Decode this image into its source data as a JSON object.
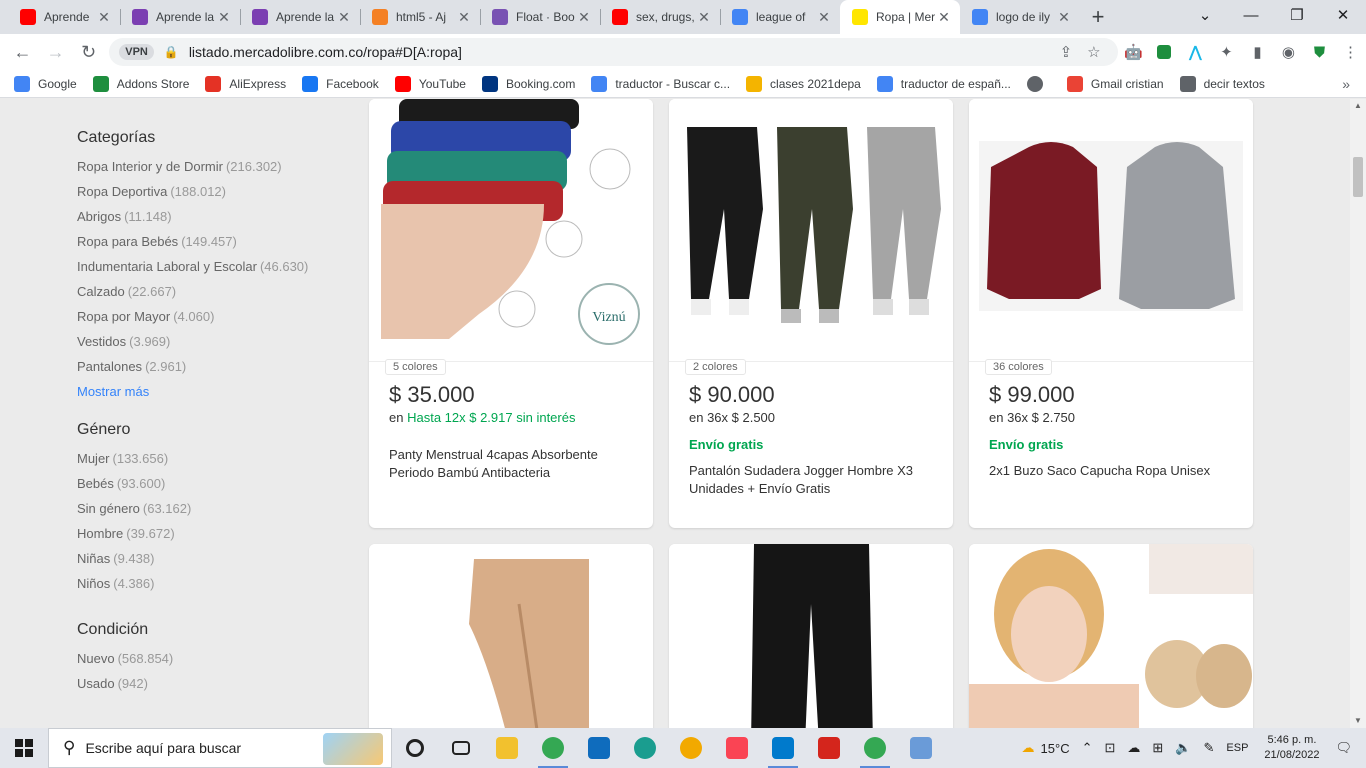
{
  "browser": {
    "tabs": [
      {
        "title": "Aprende",
        "favicon": "youtube-icon",
        "color": "#ff0000",
        "active": false
      },
      {
        "title": "Aprende la",
        "favicon": "potion-icon",
        "color": "#7b3fb2",
        "active": false
      },
      {
        "title": "Aprende la",
        "favicon": "potion-icon",
        "color": "#7b3fb2",
        "active": false
      },
      {
        "title": "html5 - Aj",
        "favicon": "stackoverflow-icon",
        "color": "#f48024",
        "active": false
      },
      {
        "title": "Float · Boo",
        "favicon": "bootstrap-icon",
        "color": "#7952b3",
        "active": false
      },
      {
        "title": "sex, drugs,",
        "favicon": "youtube-icon",
        "color": "#ff0000",
        "active": false
      },
      {
        "title": "league of",
        "favicon": "google-icon",
        "color": "#4285f4",
        "active": false
      },
      {
        "title": "Ropa | Mer",
        "favicon": "mercadolibre-icon",
        "color": "#ffe600",
        "active": true
      },
      {
        "title": "logo de ily",
        "favicon": "google-icon",
        "color": "#4285f4",
        "active": false
      }
    ],
    "url": "listado.mercadolibre.com.co/ropa#D[A:ropa]",
    "vpn_label": "VPN",
    "bookmarks": [
      {
        "label": "Google",
        "icon": "google-icon",
        "color": "#4285f4"
      },
      {
        "label": "Addons Store",
        "icon": "addons-icon",
        "color": "#1e8e3e"
      },
      {
        "label": "AliExpress",
        "icon": "aliexpress-icon",
        "color": "#e43225"
      },
      {
        "label": "Facebook",
        "icon": "facebook-icon",
        "color": "#1877f2"
      },
      {
        "label": "YouTube",
        "icon": "youtube-icon",
        "color": "#ff0000"
      },
      {
        "label": "Booking.com",
        "icon": "booking-icon",
        "color": "#003580"
      },
      {
        "label": "traductor - Buscar c...",
        "icon": "google-icon",
        "color": "#4285f4"
      },
      {
        "label": "clases 2021depa",
        "icon": "classroom-icon",
        "color": "#f4b400"
      },
      {
        "label": "traductor de españ...",
        "icon": "google-icon",
        "color": "#4285f4"
      },
      {
        "label": "",
        "icon": "globe-icon",
        "color": "#5f6368"
      },
      {
        "label": "Gmail cristian",
        "icon": "gmail-icon",
        "color": "#ea4335"
      },
      {
        "label": "decir textos",
        "icon": "speaker-icon",
        "color": "#5f6368"
      }
    ]
  },
  "filters": [
    {
      "title": "Categorías",
      "items": [
        {
          "label": "Ropa Interior y de Dormir",
          "count": "(216.302)"
        },
        {
          "label": "Ropa Deportiva",
          "count": "(188.012)"
        },
        {
          "label": "Abrigos",
          "count": "(11.148)"
        },
        {
          "label": "Ropa para Bebés",
          "count": "(149.457)"
        },
        {
          "label": "Indumentaria Laboral y Escolar",
          "count": "(46.630)"
        },
        {
          "label": "Calzado",
          "count": "(22.667)"
        },
        {
          "label": "Ropa por Mayor",
          "count": "(4.060)"
        },
        {
          "label": "Vestidos",
          "count": "(3.969)"
        },
        {
          "label": "Pantalones",
          "count": "(2.961)"
        }
      ],
      "more": "Mostrar más"
    },
    {
      "title": "Género",
      "items": [
        {
          "label": "Mujer",
          "count": "(133.656)"
        },
        {
          "label": "Bebés",
          "count": "(93.600)"
        },
        {
          "label": "Sin género",
          "count": "(63.162)"
        },
        {
          "label": "Hombre",
          "count": "(39.672)"
        },
        {
          "label": "Niñas",
          "count": "(9.438)"
        },
        {
          "label": "Niños",
          "count": "(4.386)"
        }
      ],
      "more": ""
    },
    {
      "title": "Condición",
      "items": [
        {
          "label": "Nuevo",
          "count": "(568.854)"
        },
        {
          "label": "Usado",
          "count": "(942)"
        }
      ],
      "more": ""
    }
  ],
  "products": [
    {
      "colors": "5 colores",
      "price": "$ 35.000",
      "installments": "en",
      "installments_green": "Hasta 12x $ 2.917 sin interés",
      "shipping": "",
      "title": "Panty Menstrual 4capas Absorbente Periodo Bambú Antibacteria",
      "image": "underwear-image",
      "brand": "Viznú"
    },
    {
      "colors": "2 colores",
      "price": "$ 90.000",
      "installments": "en 36x $ 2.500",
      "installments_green": "",
      "shipping": "Envío gratis",
      "title": "Pantalón Sudadera Jogger Hombre X3 Unidades + Envío Gratis",
      "image": "joggers-image",
      "brand": ""
    },
    {
      "colors": "36 colores",
      "price": "$ 99.000",
      "installments": "en 36x $ 2.750",
      "installments_green": "",
      "shipping": "Envío gratis",
      "title": "2x1 Buzo Saco Capucha Ropa Unisex",
      "image": "hoodies-image",
      "brand": ""
    }
  ],
  "taskbar": {
    "search_placeholder": "Escribe aquí para buscar",
    "apps": [
      {
        "name": "cortana-icon",
        "color": "#222222",
        "running": false
      },
      {
        "name": "task-view-icon",
        "color": "#222222",
        "running": false
      },
      {
        "name": "file-explorer-icon",
        "color": "#f2c12e",
        "running": false
      },
      {
        "name": "chrome-icon",
        "color": "#34a853",
        "running": true
      },
      {
        "name": "mail-icon",
        "color": "#0f6cbd",
        "running": false
      },
      {
        "name": "edge-icon",
        "color": "#1a9d8f",
        "running": false
      },
      {
        "name": "vpn-app-icon",
        "color": "#f2a900",
        "running": false
      },
      {
        "name": "valorant-icon",
        "color": "#fa4454",
        "running": false
      },
      {
        "name": "vscode-icon",
        "color": "#007acc",
        "running": true
      },
      {
        "name": "acrobat-icon",
        "color": "#d4251c",
        "running": false
      },
      {
        "name": "chrome-icon",
        "color": "#34a853",
        "running": true
      },
      {
        "name": "paint-icon",
        "color": "#6a9bd8",
        "running": false
      }
    ],
    "weather": "15°C",
    "language": "ESP",
    "time": "5:46 p. m.",
    "date": "21/08/2022"
  }
}
